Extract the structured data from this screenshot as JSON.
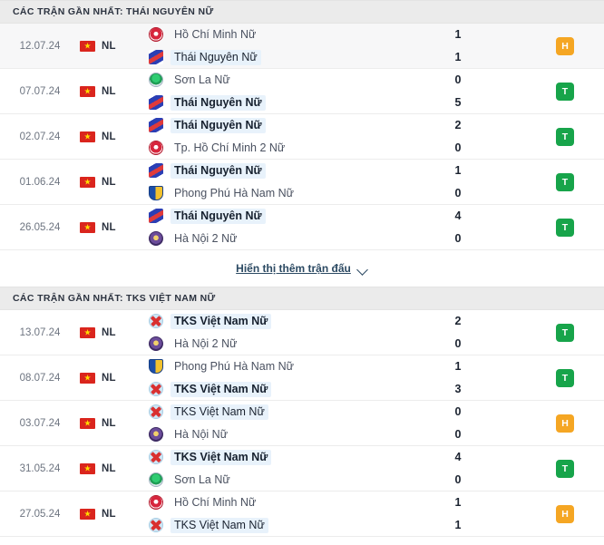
{
  "sections": [
    {
      "title": "CÁC TRẬN GẦN NHẤT: THÁI NGUYÊN NỮ",
      "matches": [
        {
          "date": "12.07.24",
          "competition": "NL",
          "flag": "vietnam-flag",
          "home": {
            "name": "Hồ Chí Minh Nữ",
            "logo": "crest-red",
            "focus": false,
            "winner": false
          },
          "away": {
            "name": "Thái Nguyên Nữ",
            "logo": "crest-triangle",
            "focus": true,
            "winner": false
          },
          "home_score": "1",
          "away_score": "1",
          "result": "H",
          "result_type": "draw",
          "highlight": true
        },
        {
          "date": "07.07.24",
          "competition": "NL",
          "flag": "vietnam-flag",
          "home": {
            "name": "Sơn La Nữ",
            "logo": "crest-green",
            "focus": false,
            "winner": false
          },
          "away": {
            "name": "Thái Nguyên Nữ",
            "logo": "crest-triangle",
            "focus": true,
            "winner": true
          },
          "home_score": "0",
          "away_score": "5",
          "result": "T",
          "result_type": "win",
          "highlight": false
        },
        {
          "date": "02.07.24",
          "competition": "NL",
          "flag": "vietnam-flag",
          "home": {
            "name": "Thái Nguyên Nữ",
            "logo": "crest-triangle",
            "focus": true,
            "winner": true
          },
          "away": {
            "name": "Tp. Hồ Chí Minh 2 Nữ",
            "logo": "crest-red",
            "focus": false,
            "winner": false
          },
          "home_score": "2",
          "away_score": "0",
          "result": "T",
          "result_type": "win",
          "highlight": false
        },
        {
          "date": "01.06.24",
          "competition": "NL",
          "flag": "vietnam-flag",
          "home": {
            "name": "Thái Nguyên Nữ",
            "logo": "crest-triangle",
            "focus": true,
            "winner": true
          },
          "away": {
            "name": "Phong Phú Hà Nam Nữ",
            "logo": "crest-shield",
            "focus": false,
            "winner": false
          },
          "home_score": "1",
          "away_score": "0",
          "result": "T",
          "result_type": "win",
          "highlight": false
        },
        {
          "date": "26.05.24",
          "competition": "NL",
          "flag": "vietnam-flag",
          "home": {
            "name": "Thái Nguyên Nữ",
            "logo": "crest-triangle",
            "focus": true,
            "winner": true
          },
          "away": {
            "name": "Hà Nội 2 Nữ",
            "logo": "crest-purple",
            "focus": false,
            "winner": false
          },
          "home_score": "4",
          "away_score": "0",
          "result": "T",
          "result_type": "win",
          "highlight": false
        }
      ],
      "show_more": "Hiển thị thêm trận đấu"
    },
    {
      "title": "CÁC TRẬN GẦN NHẤT: TKS VIỆT NAM NỮ",
      "matches": [
        {
          "date": "13.07.24",
          "competition": "NL",
          "flag": "vietnam-flag",
          "home": {
            "name": "TKS Việt Nam Nữ",
            "logo": "crest-tks",
            "focus": true,
            "winner": true
          },
          "away": {
            "name": "Hà Nội 2 Nữ",
            "logo": "crest-purple",
            "focus": false,
            "winner": false
          },
          "home_score": "2",
          "away_score": "0",
          "result": "T",
          "result_type": "win",
          "highlight": false
        },
        {
          "date": "08.07.24",
          "competition": "NL",
          "flag": "vietnam-flag",
          "home": {
            "name": "Phong Phú Hà Nam Nữ",
            "logo": "crest-shield",
            "focus": false,
            "winner": false
          },
          "away": {
            "name": "TKS Việt Nam Nữ",
            "logo": "crest-tks",
            "focus": true,
            "winner": true
          },
          "home_score": "1",
          "away_score": "3",
          "result": "T",
          "result_type": "win",
          "highlight": false
        },
        {
          "date": "03.07.24",
          "competition": "NL",
          "flag": "vietnam-flag",
          "home": {
            "name": "TKS Việt Nam Nữ",
            "logo": "crest-tks",
            "focus": true,
            "winner": false
          },
          "away": {
            "name": "Hà Nội Nữ",
            "logo": "crest-purple",
            "focus": false,
            "winner": false
          },
          "home_score": "0",
          "away_score": "0",
          "result": "H",
          "result_type": "draw",
          "highlight": false
        },
        {
          "date": "31.05.24",
          "competition": "NL",
          "flag": "vietnam-flag",
          "home": {
            "name": "TKS Việt Nam Nữ",
            "logo": "crest-tks",
            "focus": true,
            "winner": true
          },
          "away": {
            "name": "Sơn La Nữ",
            "logo": "crest-green",
            "focus": false,
            "winner": false
          },
          "home_score": "4",
          "away_score": "0",
          "result": "T",
          "result_type": "win",
          "highlight": false
        },
        {
          "date": "27.05.24",
          "competition": "NL",
          "flag": "vietnam-flag",
          "home": {
            "name": "Hồ Chí Minh Nữ",
            "logo": "crest-red",
            "focus": false,
            "winner": false
          },
          "away": {
            "name": "TKS Việt Nam Nữ",
            "logo": "crest-tks",
            "focus": true,
            "winner": false
          },
          "home_score": "1",
          "away_score": "1",
          "result": "H",
          "result_type": "draw",
          "highlight": false
        }
      ],
      "show_more": null
    }
  ],
  "colors": {
    "win": "#17a44a",
    "draw": "#f5a623",
    "header_bg": "#ebebeb",
    "focus_bg": "#e8f2fb"
  }
}
